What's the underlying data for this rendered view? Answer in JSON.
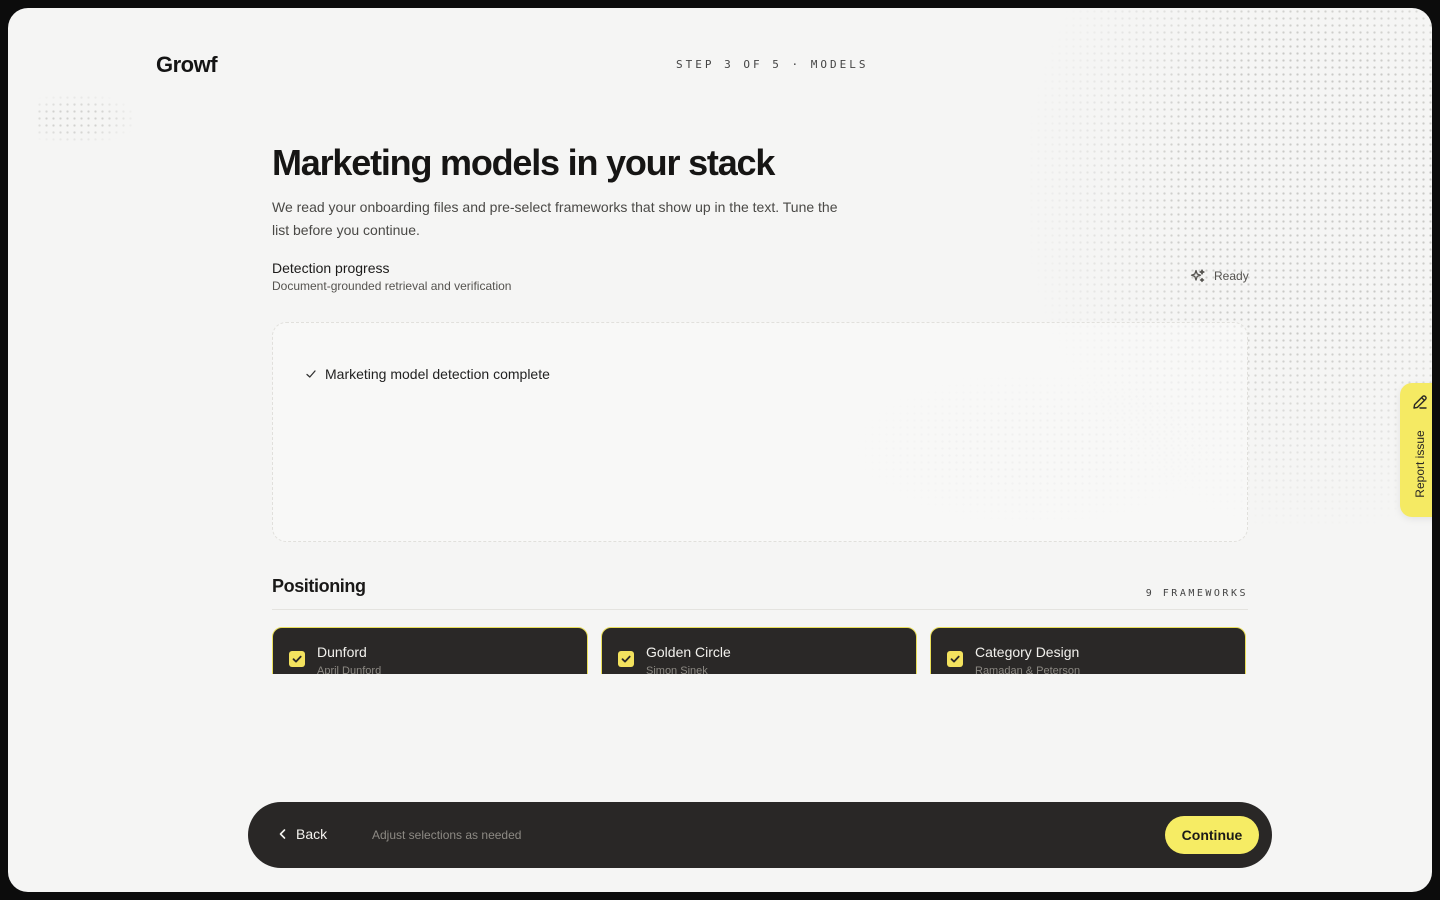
{
  "header": {
    "logo": "Growf",
    "step": "STEP 3 OF 5 · MODELS"
  },
  "page": {
    "title": "Marketing models in your stack",
    "intro": "We read your onboarding files and pre-select frameworks that show up in the text. Tune the list before you continue."
  },
  "progress": {
    "title": "Detection progress",
    "subtitle": "Document-grounded retrieval and verification",
    "status": "Ready",
    "status_icon": "sparkle-icon",
    "log": [
      {
        "icon": "check-icon",
        "text": "Marketing model detection complete"
      }
    ]
  },
  "section": {
    "title": "Positioning",
    "count": "9 FRAMEWORKS",
    "cards": [
      {
        "name": "Dunford",
        "author": "April Dunford",
        "checked": true
      },
      {
        "name": "Golden Circle",
        "author": "Simon Sinek",
        "checked": true
      },
      {
        "name": "Category Design",
        "author": "Ramadan & Peterson",
        "checked": true
      }
    ]
  },
  "footer": {
    "back_label": "Back",
    "hint": "Adjust selections as needed",
    "continue_label": "Continue"
  },
  "feedback_tab": {
    "label": "Report issue",
    "icon": "pencil-icon"
  },
  "colors": {
    "accent": "#F6EC64",
    "dark": "#292726",
    "background": "#F5F5F4",
    "card_border": "#E9DE5A"
  }
}
